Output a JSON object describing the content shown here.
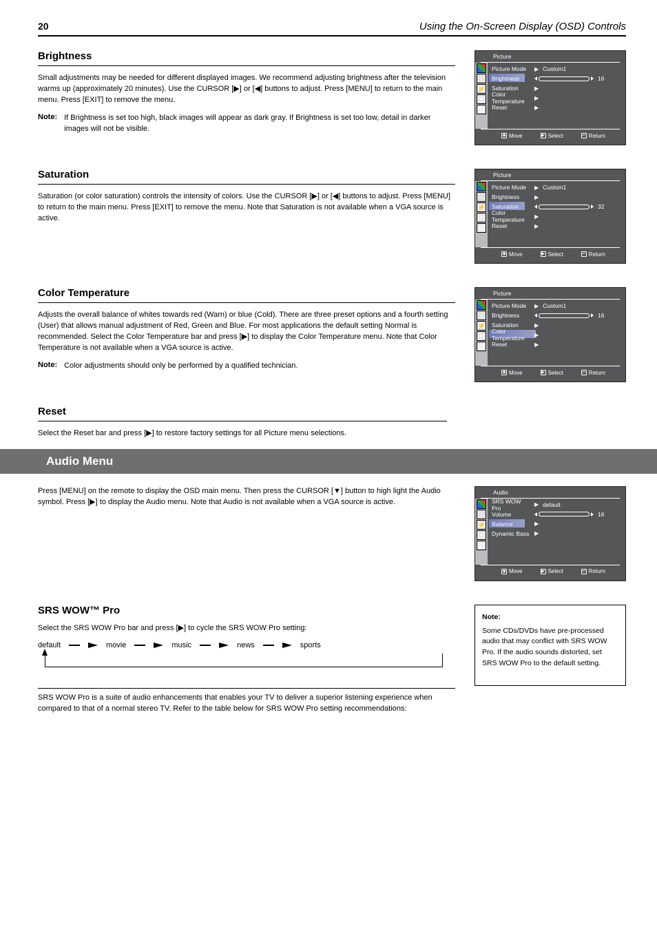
{
  "page": {
    "number": "20",
    "header": "Using the On-Screen Display (OSD) Controls"
  },
  "sec_brightness": {
    "heading": "Brightness",
    "body": "Small adjustments may be needed for different displayed images. We recommend adjusting brightness after the television warms up (approximately 20 minutes). Use the CURSOR [▶] or [◀] buttons to adjust. Press [MENU] to return to the main menu. Press [EXIT] to remove the menu.",
    "note_label": "Note:",
    "note_text": "If Brightness is set too high, black images will appear as dark gray. If Brightness is set too low, detail in darker images will not be visible."
  },
  "sec_saturation": {
    "heading": "Saturation",
    "body": "Saturation (or color saturation) controls the intensity of colors. Use the CURSOR [▶] or [◀] buttons to adjust. Press [MENU] to return to the main menu. Press [EXIT] to remove the menu. Note that Saturation is not available when a VGA source is active."
  },
  "sec_colortemp": {
    "heading": "Color Temperature",
    "body": "Adjusts the overall balance of whites towards red (Warn) or blue (Cold). There are three preset options and a fourth setting (User) that allows manual adjustment of Red, Green and Blue. For most applications the default setting Normal is recommended. Select the Color Temperature bar and press [▶] to display the Color Temperature menu. Note that Color Temperature is not available when a VGA source is active.",
    "note_label": "Note:",
    "note_text": "Color adjustments should only be performed by a qualified technician."
  },
  "sec_reset": {
    "heading": "Reset",
    "body": "Select the Reset bar and press [▶] to restore factory settings for all Picture menu selections."
  },
  "audio_band": "Audio Menu",
  "audio_body": "Press [MENU] on the remote to display the OSD main menu. Then press the CURSOR [▼] button to high light the Audio symbol. Press [▶] to display the Audio menu. Note that Audio is not available when a VGA source is active.",
  "srs_heading": "SRS WOW™ Pro",
  "srs_body1": "Select the SRS WOW Pro bar and press [▶] to cycle the SRS WOW Pro setting:",
  "format_steps": [
    "default",
    "movie",
    "music",
    "news",
    "sports"
  ],
  "srs_body2": "SRS WOW Pro is a suite of audio enhancements that enables your TV to deliver a superior listening experience when compared to that of a normal stereo TV. Refer to the table below for SRS WOW Pro setting recommendations:",
  "note_box": {
    "heading": "Note:",
    "body": "Some CDs/DVDs have pre-processed audio that may conflict with SRS WOW Pro. If the audio sounds distorted, set SRS WOW Pro to the default setting."
  },
  "osd": {
    "picture_title": "Picture",
    "audio_title": "Audio",
    "items": {
      "picture_mode": {
        "label": "Picture Mode",
        "value": "Custom1"
      },
      "brightness": {
        "label": "Brightness",
        "value": "16"
      },
      "saturation": {
        "label": "Saturation",
        "value": "32"
      },
      "color_temp": {
        "label": "Color Temperature"
      },
      "reset": {
        "label": "Reset"
      },
      "srs_wow": {
        "label": "SRS WOW Pro",
        "value": "default"
      },
      "volume": {
        "label": "Volume",
        "value": "16"
      },
      "balance": {
        "label": "Balance"
      },
      "dyn_bass": {
        "label": "Dynamic Bass"
      }
    },
    "footer": {
      "move": "Move",
      "select": "Select",
      "return": "Return"
    }
  }
}
